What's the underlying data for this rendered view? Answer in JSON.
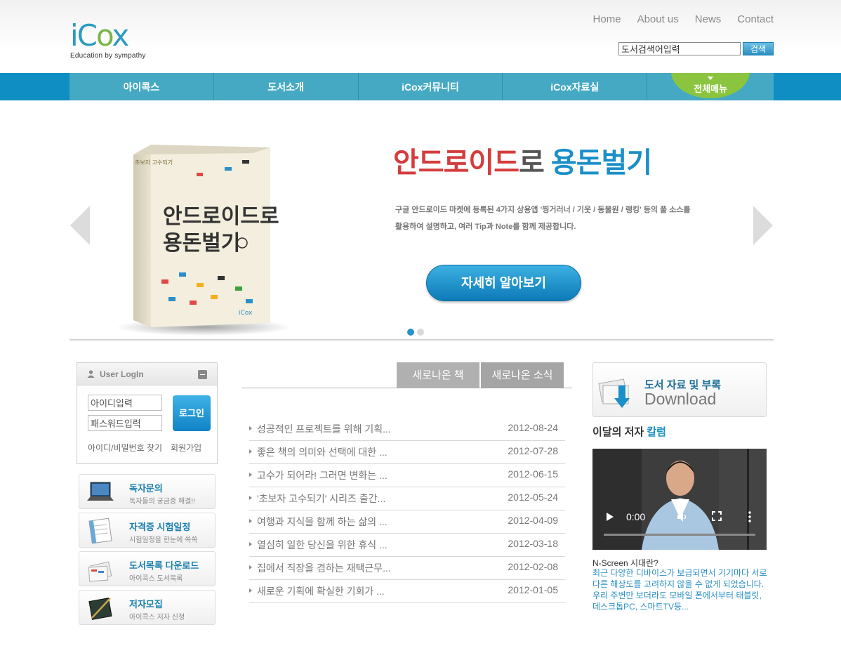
{
  "header": {
    "logo_text": "iCox",
    "logo_tagline": "Education by sympathy",
    "top_nav": [
      "Home",
      "About us",
      "News",
      "Contact"
    ],
    "search": {
      "value": "도서검색어입력",
      "button_label": "검색"
    }
  },
  "main_nav": {
    "items": [
      "아이콕스",
      "도서소개",
      "iCox커뮤니티",
      "iCox자료실"
    ],
    "all_menu_label": "전체메뉴"
  },
  "banner": {
    "title_part1": "안드로이드",
    "title_part2": "로 ",
    "title_part3": "용돈벌기",
    "desc_line1": "구글 안드로이드 마켓에 등록된 4가지 상용앱 '찡거러너 / 기웃 / 동물원 / 랭킹' 등의 풀 소스를",
    "desc_line2": "활용하여 설명하고, 여러 Tip과 Note를 함께 제공합니다.",
    "button_label": "자세히 알아보기",
    "book_title_line1": "안드로이드로",
    "book_title_line2": "용돈벌기",
    "book_series": "초보자 고수되기",
    "book_publisher": "iCox"
  },
  "login": {
    "title": "User LogIn",
    "id_value": "아이디입력",
    "pw_value": "패스워드입력",
    "button_label": "로그인",
    "find_link": "아이디/비밀번호 찾기",
    "join_link": "회원가입"
  },
  "side_menu": [
    {
      "title": "독자문의",
      "subtitle": "독자들의 궁금증 해결!!",
      "icon": "laptop-icon"
    },
    {
      "title": "자격증 시험일정",
      "subtitle": "시험일정을 한눈에 쏙쏙",
      "icon": "calendar-icon"
    },
    {
      "title": "도서목록 다운로드",
      "subtitle": "아이콕스 도서목록",
      "icon": "book-list-icon"
    },
    {
      "title": "저자모집",
      "subtitle": "아이콕스 저자 신청",
      "icon": "pen-notebook-icon"
    }
  ],
  "tabs": [
    "새로나온 책",
    "새로나온 소식"
  ],
  "news": [
    {
      "title": "성공적인 프로젝트를 위해 기획...",
      "date": "2012-08-24"
    },
    {
      "title": "좋은 책의 의미와 선택에 대한 ...",
      "date": "2012-07-28"
    },
    {
      "title": "고수가 되어라! 그러면 변화는 ...",
      "date": "2012-06-15"
    },
    {
      "title": "'초보자 고수되기' 시리즈 출간...",
      "date": "2012-05-24"
    },
    {
      "title": "여행과 지식을 함께 하는 삶의 ...",
      "date": "2012-04-09"
    },
    {
      "title": "열심히 일한 당신을 위한 휴식 ...",
      "date": "2012-03-18"
    },
    {
      "title": "집에서 직장을 겸하는 재택근무...",
      "date": "2012-02-08"
    },
    {
      "title": "새로운 기획에 확실한 기회가 ...",
      "date": "2012-01-05"
    }
  ],
  "download_card": {
    "title": "도서 자료 및 부록",
    "subtitle": "Download"
  },
  "column": {
    "title_part1": "이달의 저자 ",
    "title_part2": "칼럼",
    "video_time": "0:00",
    "subtitle": "N-Screen 시대란?",
    "text": "최근 다양한 디바이스가 보급되면서 기기마다 서로 다른 해상도를 고려하지 않을 수 없게 되었습니다. 우리 주변만 보더라도 모바일 폰에서부터 태블릿, 데스크톱PC, 스마트TV등..."
  },
  "colors": {
    "nav_blue": "#0f8ec4",
    "nav_item": "#45a9c4",
    "all_menu_green": "#8bc53f",
    "title_red": "#d43d3d",
    "title_blue": "#1a8fc8"
  }
}
